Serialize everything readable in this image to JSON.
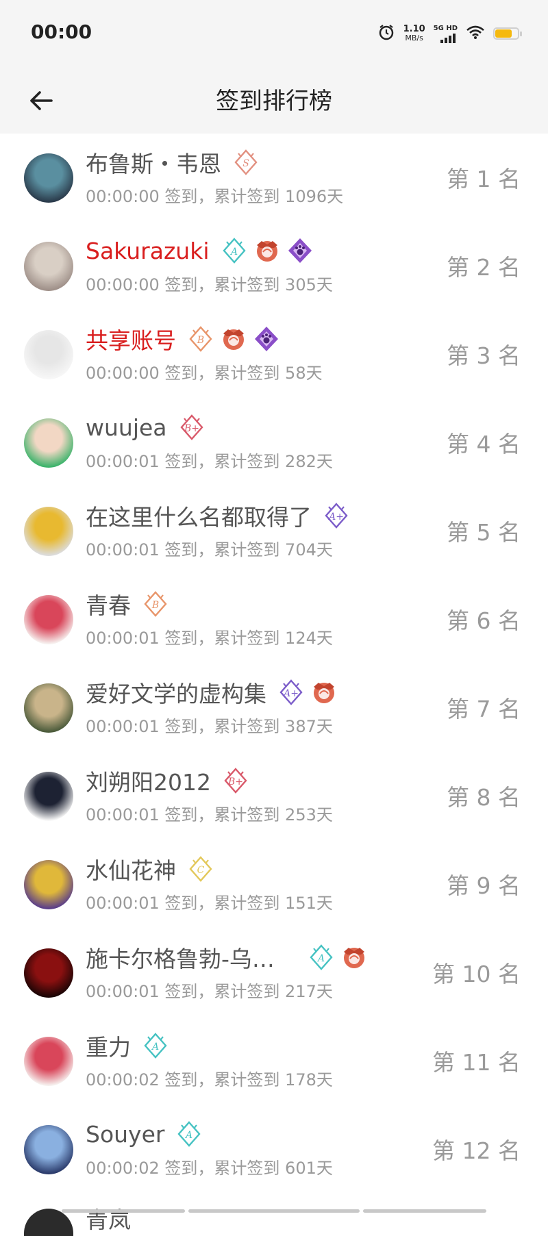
{
  "status_bar": {
    "time": "00:00",
    "net_speed_value": "1.10",
    "net_speed_unit": "MB/s",
    "signal_label": "5G HD",
    "battery_level": 0.75,
    "icons": [
      "alarm-icon",
      "signal-icon",
      "wifi-icon",
      "battery-icon"
    ]
  },
  "header": {
    "title": "签到排行榜",
    "back_icon": "arrow-left-icon"
  },
  "colors": {
    "vip_name": "#d91e1e",
    "normal_name": "#555555",
    "secondary_text": "#9a9a9a",
    "header_bg": "#f5f5f5"
  },
  "rankings": [
    {
      "name": "布鲁斯・韦恩",
      "vip": false,
      "checkin": "00:00:00 签到，累计签到 1096天",
      "rank": "第 1 名",
      "badges": [
        {
          "type": "letter",
          "letter": "S",
          "color": "#e29080"
        }
      ],
      "avatar": [
        "#2a3a4a",
        "#5a8fa0"
      ]
    },
    {
      "name": "Sakurazuki",
      "vip": true,
      "checkin": "00:00:00 签到，累计签到 305天",
      "rank": "第 2 名",
      "badges": [
        {
          "type": "letter",
          "letter": "A",
          "color": "#45c2c2"
        },
        {
          "type": "crest",
          "color": "#e0684f"
        },
        {
          "type": "paw",
          "color": "#8a4ec8"
        }
      ],
      "avatar": [
        "#9e8f88",
        "#d9cfc5"
      ]
    },
    {
      "name": "共享账号",
      "vip": true,
      "checkin": "00:00:00 签到，累计签到 58天",
      "rank": "第 3 名",
      "badges": [
        {
          "type": "letter",
          "letter": "B",
          "color": "#e8956a"
        },
        {
          "type": "crest",
          "color": "#e0684f"
        },
        {
          "type": "paw",
          "color": "#8a4ec8"
        }
      ],
      "avatar": [
        "#f7f7f7",
        "#e6e6e6"
      ]
    },
    {
      "name": "wuujea",
      "vip": false,
      "checkin": "00:00:01 签到，累计签到 282天",
      "rank": "第 4 名",
      "badges": [
        {
          "type": "letter",
          "letter": "B+",
          "color": "#d9596a"
        }
      ],
      "avatar": [
        "#3bb36a",
        "#f2d7c4"
      ]
    },
    {
      "name": "在这里什么名都取得了",
      "vip": false,
      "checkin": "00:00:01 签到，累计签到 704天",
      "rank": "第 5 名",
      "badges": [
        {
          "type": "letter",
          "letter": "A+",
          "color": "#7b5cc9"
        }
      ],
      "avatar": [
        "#dcdcdc",
        "#e8b930"
      ]
    },
    {
      "name": "青春",
      "vip": false,
      "checkin": "00:00:01 签到，累计签到 124天",
      "rank": "第 6 名",
      "badges": [
        {
          "type": "letter",
          "letter": "B",
          "color": "#e8956a"
        }
      ],
      "avatar": [
        "#f6f0ee",
        "#d9465a"
      ]
    },
    {
      "name": "爱好文学的虚构集",
      "vip": false,
      "checkin": "00:00:01 签到，累计签到 387天",
      "rank": "第 7 名",
      "badges": [
        {
          "type": "letter",
          "letter": "A+",
          "color": "#7b5cc9"
        },
        {
          "type": "crest",
          "color": "#e0684f"
        }
      ],
      "avatar": [
        "#4a5a3a",
        "#c9b48a"
      ]
    },
    {
      "name": "刘朔阳2012",
      "vip": false,
      "checkin": "00:00:01 签到，累计签到 253天",
      "rank": "第 8 名",
      "badges": [
        {
          "type": "letter",
          "letter": "B+",
          "color": "#d9596a"
        }
      ],
      "avatar": [
        "#f7f7f7",
        "#1d2233"
      ]
    },
    {
      "name": "水仙花神",
      "vip": false,
      "checkin": "00:00:01 签到，累计签到 151天",
      "rank": "第 9 名",
      "badges": [
        {
          "type": "letter",
          "letter": "C",
          "color": "#e3c85a"
        }
      ],
      "avatar": [
        "#5a3d8a",
        "#e0b83a"
      ]
    },
    {
      "name": "施卡尔格鲁勃-乌…",
      "vip": false,
      "checkin": "00:00:01 签到，累计签到 217天",
      "rank": "第 10 名",
      "badges": [
        {
          "type": "letter",
          "letter": "A",
          "color": "#45c2c2"
        },
        {
          "type": "crest",
          "color": "#e0684f"
        }
      ],
      "avatar": [
        "#1a0505",
        "#8a1010"
      ]
    },
    {
      "name": "重力",
      "vip": false,
      "checkin": "00:00:02 签到，累计签到 178天",
      "rank": "第 11 名",
      "badges": [
        {
          "type": "letter",
          "letter": "A",
          "color": "#45c2c2"
        }
      ],
      "avatar": [
        "#f6f0ee",
        "#d9465a"
      ]
    },
    {
      "name": "Souyer",
      "vip": false,
      "checkin": "00:00:02 签到，累计签到 601天",
      "rank": "第 12 名",
      "badges": [
        {
          "type": "letter",
          "letter": "A",
          "color": "#45c2c2"
        }
      ],
      "avatar": [
        "#2a3a6a",
        "#8ab0e0"
      ]
    }
  ],
  "partial_next": {
    "name": "青岚"
  }
}
